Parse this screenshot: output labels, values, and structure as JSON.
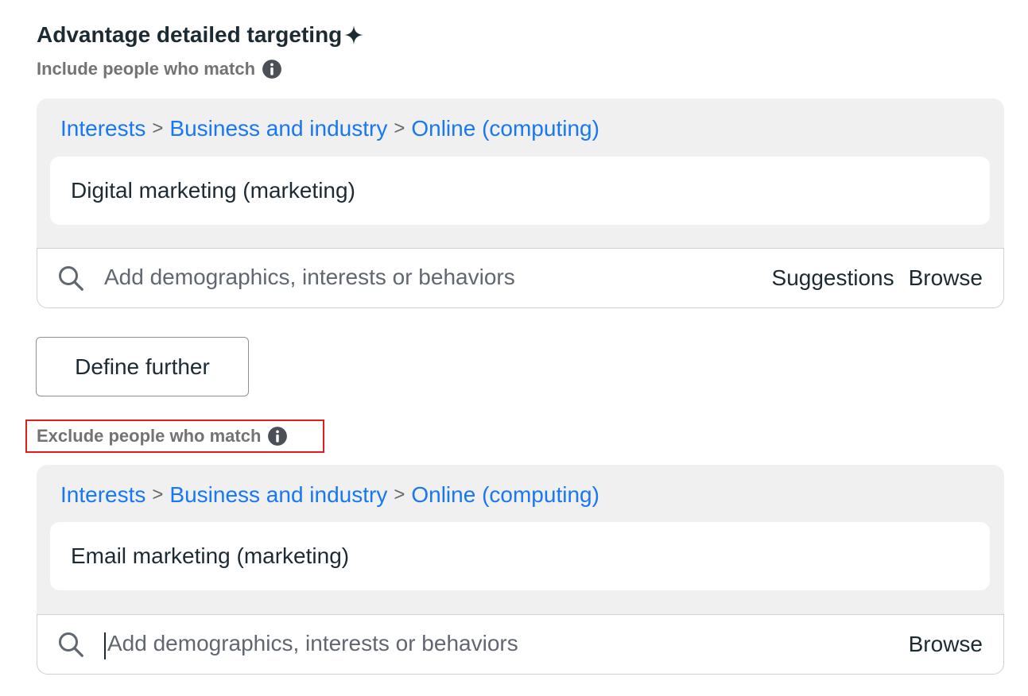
{
  "header": {
    "title": "Advantage detailed targeting",
    "title_icon": "sparkle-icon"
  },
  "include": {
    "label": "Include people who match",
    "info_icon": "info-icon",
    "breadcrumb": [
      "Interests",
      "Business and industry",
      "Online (computing)"
    ],
    "separator": ">",
    "selected_item": "Digital marketing (marketing)",
    "search": {
      "placeholder": "Add demographics, interests or behaviors",
      "value": "",
      "suggestions_label": "Suggestions",
      "browse_label": "Browse"
    }
  },
  "define_further": {
    "label": "Define further"
  },
  "exclude": {
    "label": "Exclude people who match",
    "info_icon": "info-icon",
    "breadcrumb": [
      "Interests",
      "Business and industry",
      "Online (computing)"
    ],
    "separator": ">",
    "selected_item": "Email marketing (marketing)",
    "search": {
      "placeholder": "Add demographics, interests or behaviors",
      "value": "",
      "browse_label": "Browse"
    }
  },
  "colors": {
    "link": "#1877f2",
    "text": "#1c2b33",
    "muted": "#737373",
    "card_bg": "#f0f0f0",
    "highlight": "#e31b1b"
  }
}
